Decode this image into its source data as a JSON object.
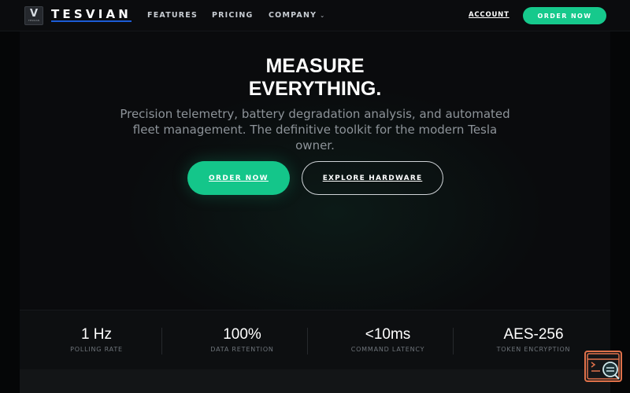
{
  "nav": {
    "logo_icon": "tesvian-logo-icon",
    "logo_letter": "V",
    "logo_small_text": "TESVIAN",
    "brand": "TESVIAN",
    "links": [
      "FEATURES",
      "PRICING",
      "COMPANY"
    ],
    "company_chevron": "chevron-down-icon",
    "account": "ACCOUNT",
    "order_button": "ORDER NOW"
  },
  "hero": {
    "title_line1": "MEASURE",
    "title_line2": "EVERYTHING.",
    "subtitle": "Precision telemetry, battery degradation analysis, and automated fleet management. The definitive toolkit for the modern Tesla owner.",
    "primary_button": "ORDER NOW",
    "secondary_button": "EXPLORE HARDWARE"
  },
  "stats": [
    {
      "value": "1 Hz",
      "label": "POLLING RATE"
    },
    {
      "value": "100%",
      "label": "DATA RETENTION"
    },
    {
      "value": "<10ms",
      "label": "COMMAND LATENCY"
    },
    {
      "value": "AES-256",
      "label": "TOKEN ENCRYPTION"
    }
  ],
  "widget": {
    "icon": "code-search-icon"
  },
  "colors": {
    "accent": "#16c98c",
    "brand_underline": "#1c5cd6",
    "widget_border": "#e0714a",
    "background": "#050607"
  }
}
